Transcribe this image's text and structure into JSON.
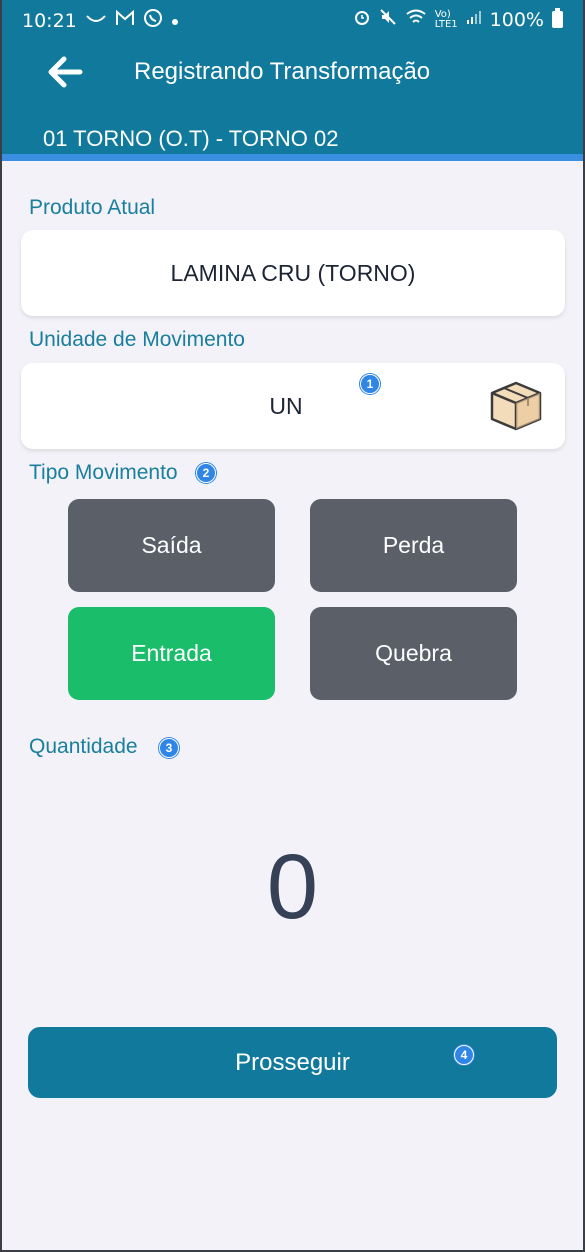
{
  "status_bar": {
    "time": "10:21",
    "battery": "100%",
    "icons": [
      "missed-call-icon",
      "gmail-icon",
      "whatsapp-icon",
      "dot-icon",
      "alarm-icon",
      "mute-icon",
      "wifi-icon",
      "volte-icon",
      "signal-icon",
      "battery-icon"
    ]
  },
  "app_bar": {
    "title": "Registrando Transformação",
    "subtitle": "01 TORNO (O.T) - TORNO 02",
    "back_icon": "arrow-left-icon"
  },
  "produto_atual": {
    "label": "Produto Atual",
    "value": "LAMINA CRU (TORNO)"
  },
  "unidade": {
    "label": "Unidade de Movimento",
    "value": "UN",
    "badge": "1",
    "icon": "box-icon"
  },
  "tipo_movimento": {
    "label": "Tipo Movimento",
    "badge": "2",
    "options": [
      {
        "label": "Saída",
        "active": false
      },
      {
        "label": "Perda",
        "active": false
      },
      {
        "label": "Entrada",
        "active": true
      },
      {
        "label": "Quebra",
        "active": false
      }
    ]
  },
  "quantidade": {
    "label": "Quantidade",
    "badge": "3",
    "value": "0"
  },
  "actions": {
    "proceed_label": "Prosseguir",
    "badge": "4"
  },
  "colors": {
    "primary": "#117a9c",
    "accent_line": "#3a8fe0",
    "active": "#19bd6a",
    "inactive": "#5a5f68",
    "badge": "#2f86e6"
  }
}
